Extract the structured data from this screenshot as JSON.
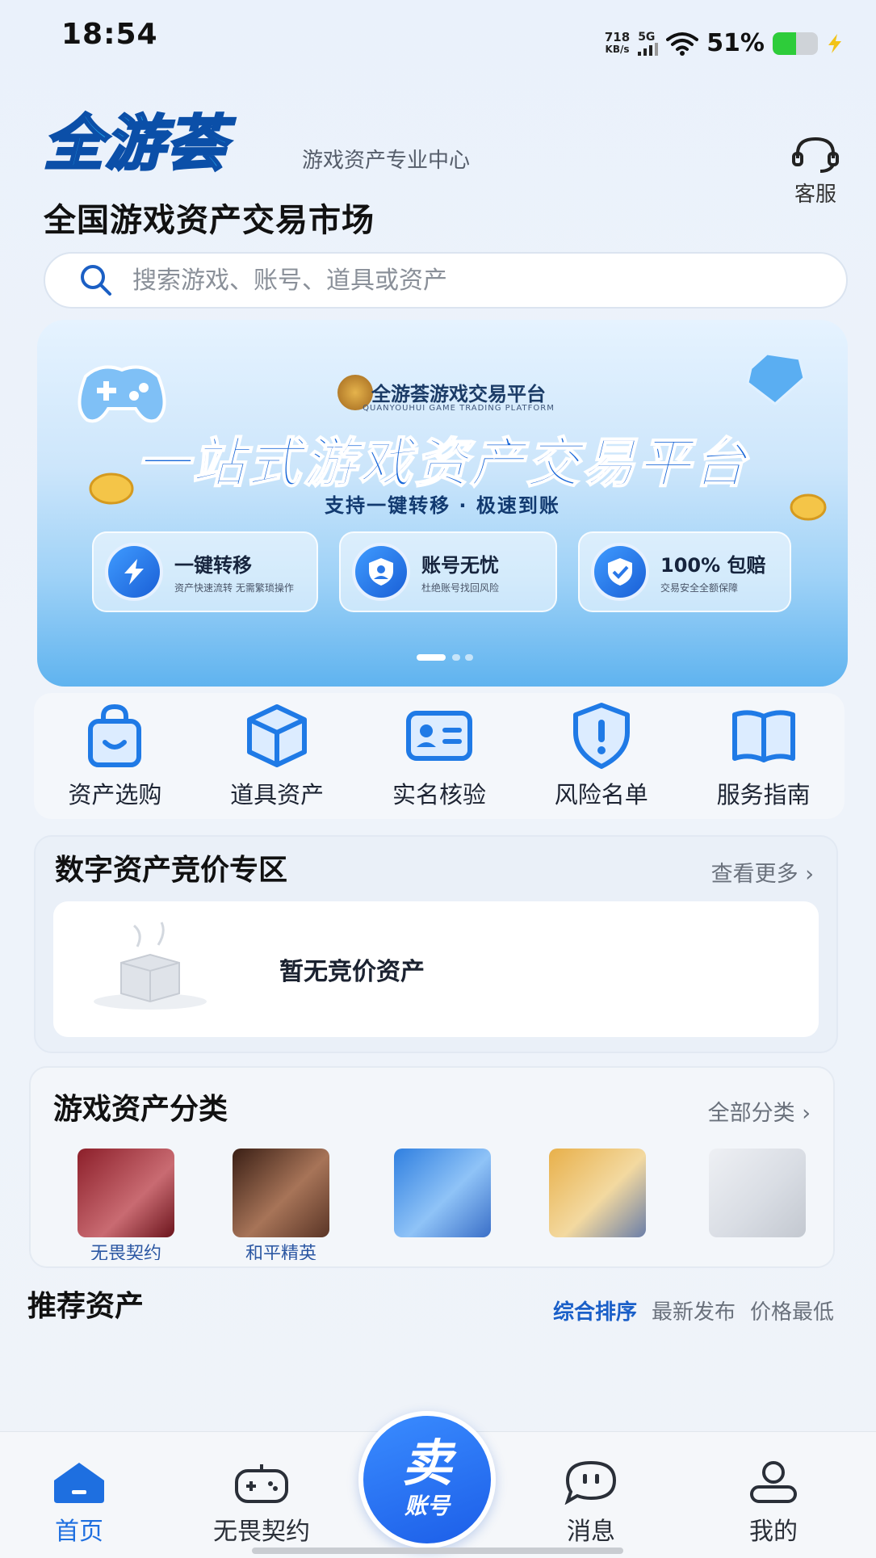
{
  "status_bar": {
    "time": "18:54",
    "net_speed_value": "718",
    "net_speed_unit": "KB/s",
    "network": "5G",
    "battery_percent": "51%",
    "battery_level": 0.51
  },
  "header": {
    "logo_text": "全游荟",
    "logo_subtitle": "游戏资产专业中心",
    "customer_service_label": "客服",
    "page_title": "全国游戏资产交易市场"
  },
  "search": {
    "placeholder": "搜索游戏、账号、道具或资产"
  },
  "banner": {
    "brand": "全游荟游戏交易平台",
    "brand_en": "QUANYOUHUI GAME TRADING PLATFORM",
    "title": "一站式游戏资产交易平台",
    "tagline": "支持一键转移 · 极速到账",
    "features": [
      {
        "title": "一键转移",
        "desc": "资产快速流转 无需繁琐操作",
        "icon": "lightning-icon"
      },
      {
        "title": "账号无忧",
        "desc": "杜绝账号找回风险",
        "icon": "shield-user-icon"
      },
      {
        "title": "100% 包赔",
        "desc": "交易安全全额保障",
        "icon": "shield-check-icon"
      }
    ]
  },
  "quick_actions": [
    {
      "label": "资产选购",
      "icon": "shopping-bag-icon"
    },
    {
      "label": "道具资产",
      "icon": "box-icon"
    },
    {
      "label": "实名核验",
      "icon": "id-card-icon"
    },
    {
      "label": "风险名单",
      "icon": "warning-shield-icon"
    },
    {
      "label": "服务指南",
      "icon": "book-icon"
    }
  ],
  "bidding": {
    "title": "数字资产竞价专区",
    "more": "查看更多",
    "empty_text": "暂无竞价资产"
  },
  "categories": {
    "title": "游戏资产分类",
    "more": "全部分类",
    "items": [
      {
        "name": "无畏契约",
        "color": "#8c1f2a"
      },
      {
        "name": "和平精英",
        "color": "#6b3a28"
      },
      {
        "name": "",
        "color": "#2f7fe0"
      },
      {
        "name": "",
        "color": "#e8b04a"
      },
      {
        "name": "",
        "color": "#d9dde4"
      }
    ]
  },
  "recommend": {
    "title": "推荐资产",
    "sorts": [
      {
        "label": "综合排序",
        "active": true
      },
      {
        "label": "最新发布",
        "active": false
      },
      {
        "label": "价格最低",
        "active": false
      }
    ]
  },
  "bottom_nav": {
    "items": [
      {
        "label": "首页",
        "icon": "home-icon",
        "active": true
      },
      {
        "label": "无畏契约",
        "icon": "gamepad-icon",
        "active": false
      },
      {
        "label": "消息",
        "icon": "message-icon",
        "active": false
      },
      {
        "label": "我的",
        "icon": "user-icon",
        "active": false
      }
    ],
    "sell_button": {
      "line1": "卖",
      "line2": "账号"
    }
  },
  "colors": {
    "accent": "#1e6fe0",
    "icon_blue": "#1f7ae6"
  }
}
